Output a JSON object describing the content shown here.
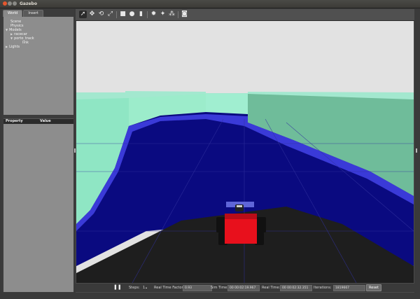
{
  "window": {
    "title": "Gazebo"
  },
  "left_panel": {
    "tabs": [
      {
        "label": "World"
      },
      {
        "label": "Insert"
      }
    ],
    "tree": {
      "scene": "Scene",
      "physics": "Physics",
      "models": "Models",
      "racecar": "racecar",
      "porto_track": "porto_track",
      "link": "link",
      "lights": "Lights"
    },
    "properties": {
      "col_property": "Property",
      "col_value": "Value"
    }
  },
  "toolbar": {
    "tools": [
      "select-icon",
      "translate-icon",
      "rotate-icon",
      "scale-icon",
      "box-icon",
      "sphere-icon",
      "cylinder-icon",
      "point-light-icon",
      "spot-light-icon",
      "directional-light-icon",
      "screenshot-icon"
    ]
  },
  "bottom_bar": {
    "steps_label": "Steps:",
    "steps_value": "1",
    "rtf_label": "Real Time Factor:",
    "rtf_value": "0.93",
    "sim_time_label": "Sim Time:",
    "sim_time_value": "00 00:02:19.967",
    "real_time_label": "Real Time:",
    "real_time_value": "00 00:02:32.351",
    "iterations_label": "Iterations:",
    "iterations_value": "1819667",
    "reset_label": "Reset"
  },
  "colors": {
    "sky": "#e2e2e2",
    "wall": "#8fe6c4",
    "floor": "#0a0a80",
    "ground": "#1e1e1e",
    "car_body": "#e8101c"
  }
}
